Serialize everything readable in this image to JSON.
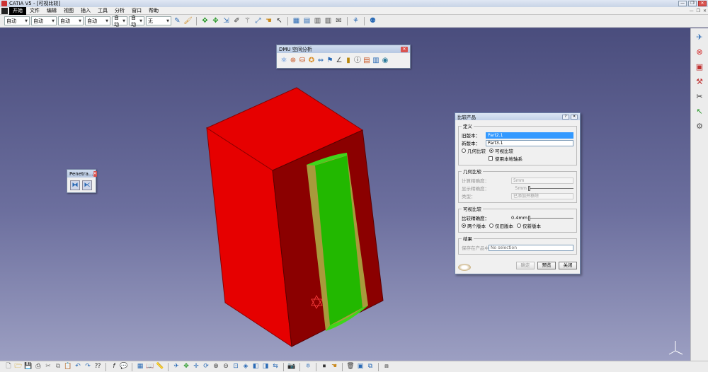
{
  "window": {
    "title": "CATIA V5 - [可视比较]",
    "buttons": [
      "—",
      "❐",
      "✕"
    ]
  },
  "menu": {
    "items": [
      "开始",
      "文件",
      "编辑",
      "视图",
      "插入",
      "工具",
      "分析",
      "窗口",
      "帮助"
    ],
    "active_index": 0,
    "mdi_buttons": [
      "—",
      "❐",
      "✕"
    ]
  },
  "toolbar": {
    "combos": [
      {
        "value": "自动",
        "width": 36
      },
      {
        "value": "自动",
        "width": 36
      },
      {
        "value": "自动",
        "width": 36
      },
      {
        "value": "自动",
        "width": 36
      },
      {
        "value": "自动",
        "width": 22
      },
      {
        "value": "自动",
        "width": 22
      },
      {
        "value": "无",
        "width": 36
      }
    ],
    "icons": [
      "paint-icon",
      "brush-icon",
      "sep",
      "move-icon",
      "move-icon",
      "snap-icon",
      "pencil-icon",
      "wand-icon",
      "manipulate-icon",
      "hand-icon",
      "cursor-icon",
      "sep",
      "table-icon",
      "table-add-icon",
      "grid-icon",
      "grid-icon",
      "note-icon",
      "sep",
      "tree-icon",
      "sep",
      "share-icon"
    ]
  },
  "dmu_toolbar": {
    "title": "DMU 空间分析",
    "icons": [
      "clash-icon",
      "distance-icon",
      "band-icon",
      "sections-icon",
      "compare-icon",
      "profile-icon",
      "angle-icon",
      "thickness-icon",
      "info-icon",
      "list-icon",
      "group-icon",
      "sphere-icon"
    ]
  },
  "penetration_toolbar": {
    "title": "Penetra..."
  },
  "dialog": {
    "title": "比较产品",
    "definition": {
      "legend": "定义",
      "old_label": "旧版本：",
      "old_value": "Part2.1",
      "new_label": "新版本：",
      "new_value": "Part3.1",
      "geo_compare": "几何比较",
      "visual_compare": "可视比较",
      "use_local_axis": "使用本地轴系"
    },
    "geometric": {
      "legend": "几何比较",
      "calc_accuracy_label": "计算精确度：",
      "calc_accuracy_value": "5mm",
      "display_accuracy_label": "显示精确度：",
      "display_accuracy_value": "5mm",
      "type_label": "类型：",
      "type_value": "已添加并移除"
    },
    "visual": {
      "legend": "可视比较",
      "accuracy_label": "比较精确度：",
      "accuracy_value": "0.4mm",
      "both_versions": "两个版本",
      "old_only": "仅旧版本",
      "new_only": "仅新版本"
    },
    "result": {
      "legend": "结果",
      "save_label": "保存在产品中",
      "save_value": "No selection"
    },
    "buttons": {
      "ok": "确定",
      "preview": "预览",
      "close": "关闭"
    }
  },
  "colors": {
    "red": "#e60000",
    "dark_red": "#8b0000",
    "green": "#22b800",
    "olive": "#a89a3c",
    "viewport_top": "#4a4d7d",
    "viewport_bottom": "#9c9fc2"
  },
  "bottom_toolbar": {
    "icons": [
      "new-icon",
      "open-icon",
      "save-icon",
      "print-icon",
      "cut-icon",
      "copy-icon",
      "paste-icon",
      "undo-icon",
      "redo-icon",
      "help-icon",
      "sep",
      "formula-icon",
      "comment-icon",
      "sep",
      "table-icon",
      "catalog-icon",
      "measure-icon",
      "sep",
      "fly-icon",
      "fit-icon",
      "pan-icon",
      "rotate-icon",
      "zoomin-icon",
      "zoomout-icon",
      "normal-view-icon",
      "iso-view-icon",
      "shading-icon",
      "hide-icon",
      "swap-icon",
      "sep",
      "camera-icon",
      "sep",
      "clash-icon",
      "sep",
      "stop-icon",
      "hand-icon",
      "sep",
      "trash-icon",
      "snapshot-icon",
      "multi-icon",
      "sep",
      "arrange-icon"
    ]
  }
}
